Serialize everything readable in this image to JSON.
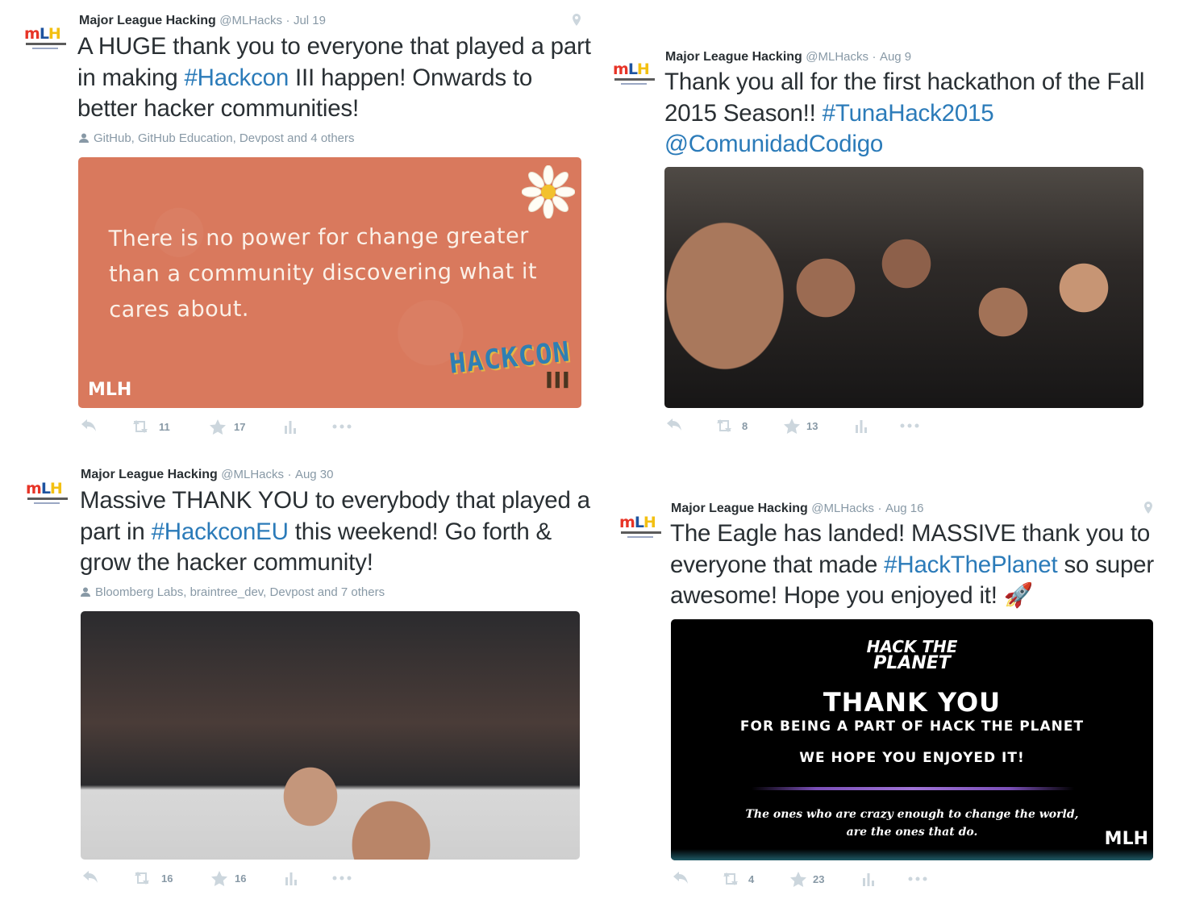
{
  "tweets": [
    {
      "author": "Major League Hacking",
      "handle": "@MLHacks",
      "date": "Jul 19",
      "text_parts": [
        "A HUGE thank you to everyone that played a part in making ",
        "#Hackcon",
        " III happen! Onwards to better hacker communities!"
      ],
      "tagged": "GitHub, GitHub Education, Devpost and 4 others",
      "media": {
        "quote": "There is no power for change greater than a community discovering what it cares about.",
        "brand": "MLH",
        "event_logo": "HACKCON",
        "event_number": "III"
      },
      "retweets": "11",
      "favorites": "17"
    },
    {
      "author": "Major League Hacking",
      "handle": "@MLHacks",
      "date": "Aug 9",
      "text_parts": [
        "Thank you all for the first hackathon of the Fall 2015 Season!! ",
        "#TunaHack2015",
        " ",
        "@ComunidadCodigo",
        ""
      ],
      "retweets": "8",
      "favorites": "13"
    },
    {
      "author": "Major League Hacking",
      "handle": "@MLHacks",
      "date": "Aug 30",
      "text_parts": [
        "Massive THANK YOU to everybody that played a part in ",
        "#HackconEU",
        " this weekend! Go forth & grow the hacker community!"
      ],
      "tagged": "Bloomberg Labs, braintree_dev, Devpost and 7 others",
      "retweets": "16",
      "favorites": "16"
    },
    {
      "author": "Major League Hacking",
      "handle": "@MLHacks",
      "date": "Aug 16",
      "text_parts": [
        "The Eagle has landed! MASSIVE thank you to everyone that made ",
        "#HackThePlanet",
        " so super awesome! Hope you enjoyed it! 🚀"
      ],
      "media": {
        "logo_line1": "HACK THE",
        "logo_line2": "PLANET",
        "headline": "THANK YOU",
        "line1": "FOR BEING A PART OF HACK THE PLANET",
        "line2": "WE HOPE YOU ENJOYED IT!",
        "quote_line1": "The ones who are crazy enough to change the world,",
        "quote_line2": "are the ones that do.",
        "brand": "MLH"
      },
      "retweets": "4",
      "favorites": "23"
    }
  ],
  "colors": {
    "link": "#2b7bb9",
    "text": "#292f33",
    "muted": "#8899a6",
    "card_orange": "#d9795d"
  },
  "icons": [
    "reply-icon",
    "retweet-icon",
    "favorite-icon",
    "analytics-icon",
    "more-icon",
    "location-pin-icon",
    "person-icon",
    "rocket-icon"
  ]
}
